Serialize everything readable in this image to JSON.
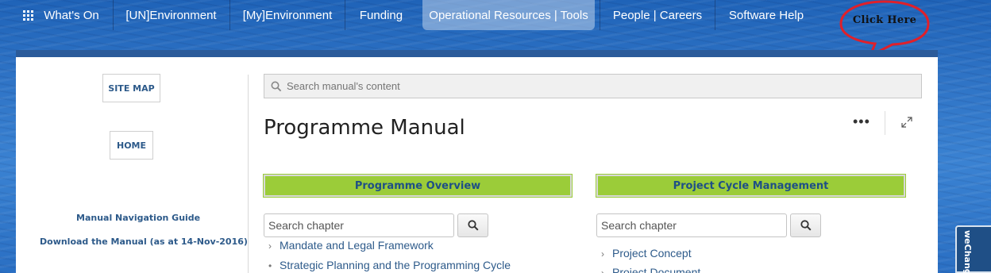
{
  "nav": {
    "items": [
      {
        "label": "What's On",
        "icon": "grid-icon"
      },
      {
        "label": "[UN]Environment"
      },
      {
        "label": "[My]Environment"
      },
      {
        "label": "Funding"
      },
      {
        "label": "Operational Resources | Tools",
        "active": true
      },
      {
        "label": "People | Careers"
      },
      {
        "label": "Software Help"
      }
    ],
    "callout": "Click Here"
  },
  "sidebar": {
    "site_map": "SITE MAP",
    "home": "HOME",
    "nav_guide": "Manual Navigation Guide",
    "download": "Download the Manual (as at 14-Nov-2016)"
  },
  "main": {
    "search_placeholder": "Search manual's content",
    "title": "Programme Manual",
    "more_icon": "ellipsis-icon",
    "expand_icon": "expand-icon"
  },
  "chapters": [
    {
      "heading": "Programme Overview",
      "search_placeholder": "Search chapter",
      "items": [
        {
          "label": "Mandate and Legal Framework",
          "marker": "›"
        },
        {
          "label": "Strategic Planning and the Programming Cycle",
          "marker": "•"
        }
      ]
    },
    {
      "heading": "Project Cycle Management",
      "search_placeholder": "Search chapter",
      "items": [
        {
          "label": "Project Concept",
          "marker": "›"
        },
        {
          "label": "Project Document",
          "marker": "›"
        }
      ]
    }
  ],
  "widget": {
    "label": "weChange"
  },
  "colors": {
    "accent_green": "#9bcc39",
    "link_blue": "#2d5a8a",
    "panel_bar": "#2b5b9a",
    "callout_red": "#e0202a"
  }
}
